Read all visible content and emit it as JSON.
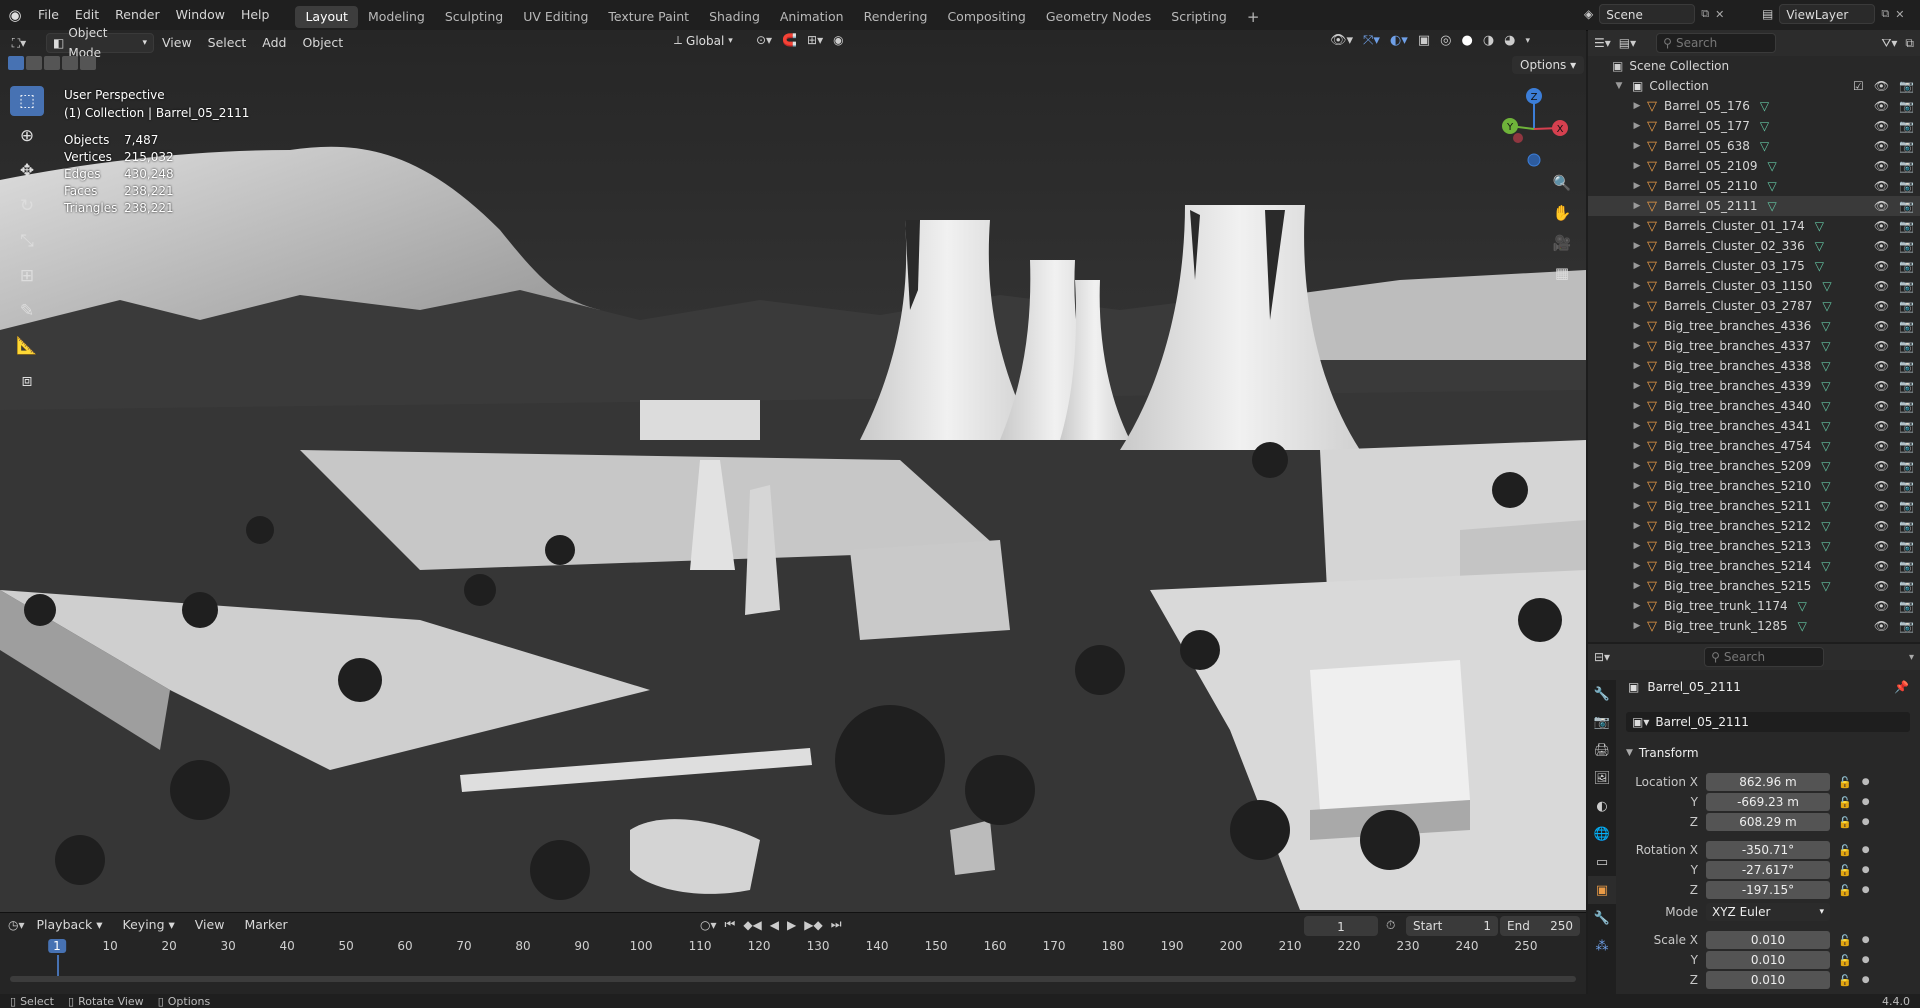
{
  "topbar": {
    "menus": [
      "File",
      "Edit",
      "Render",
      "Window",
      "Help"
    ],
    "workspaces": [
      "Layout",
      "Modeling",
      "Sculpting",
      "UV Editing",
      "Texture Paint",
      "Shading",
      "Animation",
      "Rendering",
      "Compositing",
      "Geometry Nodes",
      "Scripting"
    ],
    "active_workspace": "Layout",
    "add_tab": "+",
    "scene": "Scene",
    "view_layer": "ViewLayer"
  },
  "viewport_header": {
    "mode": "Object Mode",
    "menus": [
      "View",
      "Select",
      "Add",
      "Object"
    ],
    "transform_orientation": "Global",
    "options": "Options"
  },
  "overlay": {
    "perspective": "User Perspective",
    "collection_line": "(1) Collection | Barrel_05_2111",
    "stats": [
      {
        "label": "Objects",
        "value": "7,487"
      },
      {
        "label": "Vertices",
        "value": "215,032"
      },
      {
        "label": "Edges",
        "value": "430,248"
      },
      {
        "label": "Faces",
        "value": "238,221"
      },
      {
        "label": "Triangles",
        "value": "238,221"
      }
    ]
  },
  "gizmo": {
    "z": "Z",
    "y": "Y",
    "x": "X"
  },
  "outliner": {
    "search_placeholder": "Search",
    "scene_collection": "Scene Collection",
    "collection": "Collection",
    "items": [
      {
        "name": "Barrel_05_176",
        "selected": false
      },
      {
        "name": "Barrel_05_177",
        "selected": false
      },
      {
        "name": "Barrel_05_638",
        "selected": false
      },
      {
        "name": "Barrel_05_2109",
        "selected": false
      },
      {
        "name": "Barrel_05_2110",
        "selected": false
      },
      {
        "name": "Barrel_05_2111",
        "selected": true
      },
      {
        "name": "Barrels_Cluster_01_174",
        "selected": false
      },
      {
        "name": "Barrels_Cluster_02_336",
        "selected": false
      },
      {
        "name": "Barrels_Cluster_03_175",
        "selected": false
      },
      {
        "name": "Barrels_Cluster_03_1150",
        "selected": false
      },
      {
        "name": "Barrels_Cluster_03_2787",
        "selected": false
      },
      {
        "name": "Big_tree_branches_4336",
        "selected": false
      },
      {
        "name": "Big_tree_branches_4337",
        "selected": false
      },
      {
        "name": "Big_tree_branches_4338",
        "selected": false
      },
      {
        "name": "Big_tree_branches_4339",
        "selected": false
      },
      {
        "name": "Big_tree_branches_4340",
        "selected": false
      },
      {
        "name": "Big_tree_branches_4341",
        "selected": false
      },
      {
        "name": "Big_tree_branches_4754",
        "selected": false
      },
      {
        "name": "Big_tree_branches_5209",
        "selected": false
      },
      {
        "name": "Big_tree_branches_5210",
        "selected": false
      },
      {
        "name": "Big_tree_branches_5211",
        "selected": false
      },
      {
        "name": "Big_tree_branches_5212",
        "selected": false
      },
      {
        "name": "Big_tree_branches_5213",
        "selected": false
      },
      {
        "name": "Big_tree_branches_5214",
        "selected": false
      },
      {
        "name": "Big_tree_branches_5215",
        "selected": false
      },
      {
        "name": "Big_tree_trunk_1174",
        "selected": false
      },
      {
        "name": "Big_tree_trunk_1285",
        "selected": false
      }
    ]
  },
  "properties": {
    "search_placeholder": "Search",
    "object_name": "Barrel_05_2111",
    "datablock_name": "Barrel_05_2111",
    "transform_label": "Transform",
    "location_label": "Location X",
    "rotation_label": "Rotation X",
    "scale_label": "Scale X",
    "y_label": "Y",
    "z_label": "Z",
    "location": [
      "862.96 m",
      "-669.23 m",
      "608.29 m"
    ],
    "rotation": [
      "-350.71°",
      "-27.617°",
      "-197.15°"
    ],
    "mode_label": "Mode",
    "mode_value": "XYZ Euler",
    "scale": [
      "0.010",
      "0.010",
      "0.010"
    ]
  },
  "timeline": {
    "menus": [
      "Playback",
      "Keying",
      "View",
      "Marker"
    ],
    "current_frame": "1",
    "start_label": "Start",
    "start": "1",
    "end_label": "End",
    "end": "250",
    "ticks": [
      "1",
      "10",
      "20",
      "30",
      "40",
      "50",
      "60",
      "70",
      "80",
      "90",
      "100",
      "110",
      "120",
      "130",
      "140",
      "150",
      "160",
      "170",
      "180",
      "190",
      "200",
      "210",
      "220",
      "230",
      "240",
      "250"
    ]
  },
  "statusbar": {
    "select": "Select",
    "rotate": "Rotate View",
    "options": "Options",
    "version": "4.4.0"
  }
}
